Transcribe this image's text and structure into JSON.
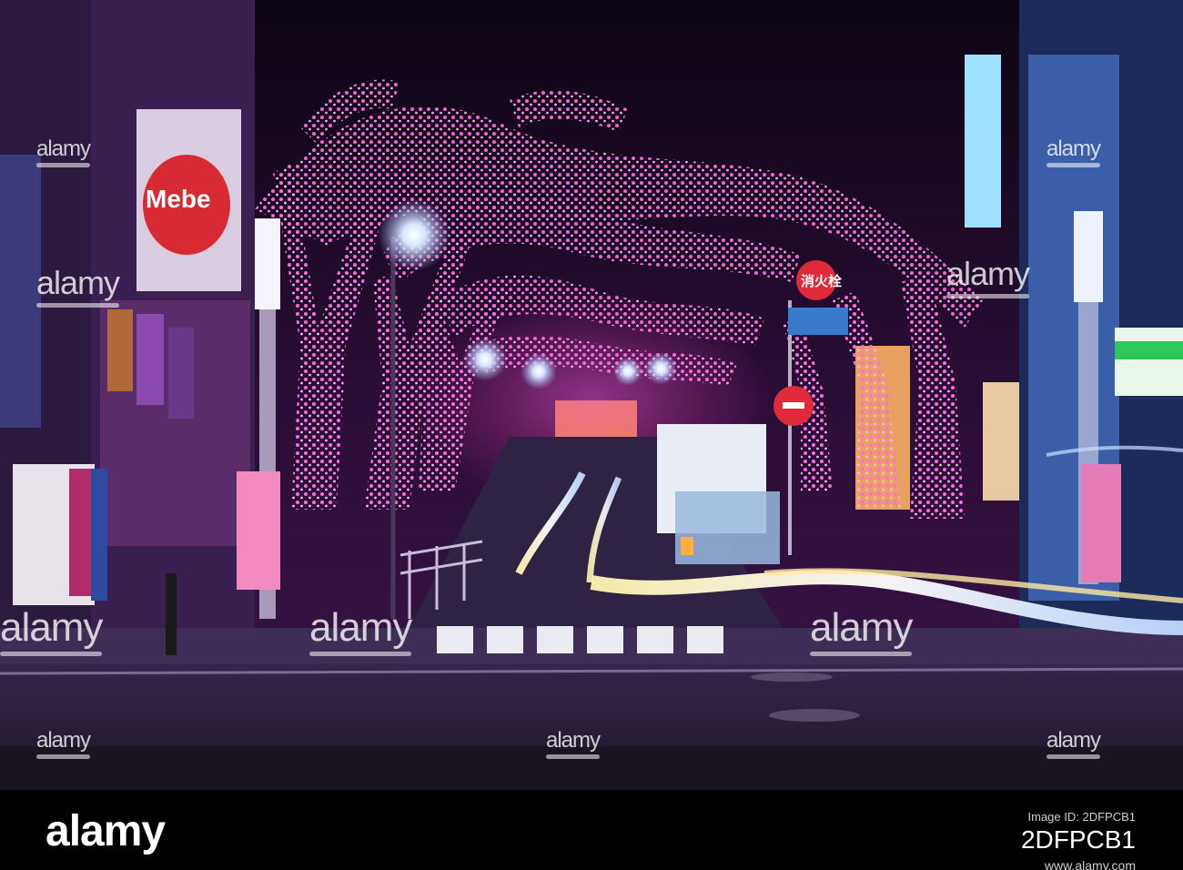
{
  "photo": {
    "description_signs": {
      "sign_hydrant": "消火栓"
    },
    "store_sign_partial": "Mebe"
  },
  "watermarks": {
    "text": "alamy"
  },
  "footer": {
    "logo": "alamy",
    "caption_label": "Image ID: ",
    "image_id": "2DFPCB1",
    "link": "www.alamy.com"
  },
  "colors": {
    "pink_lights": "#ff3cc8",
    "sky": "#16081e",
    "road": "#2a1f3a"
  }
}
